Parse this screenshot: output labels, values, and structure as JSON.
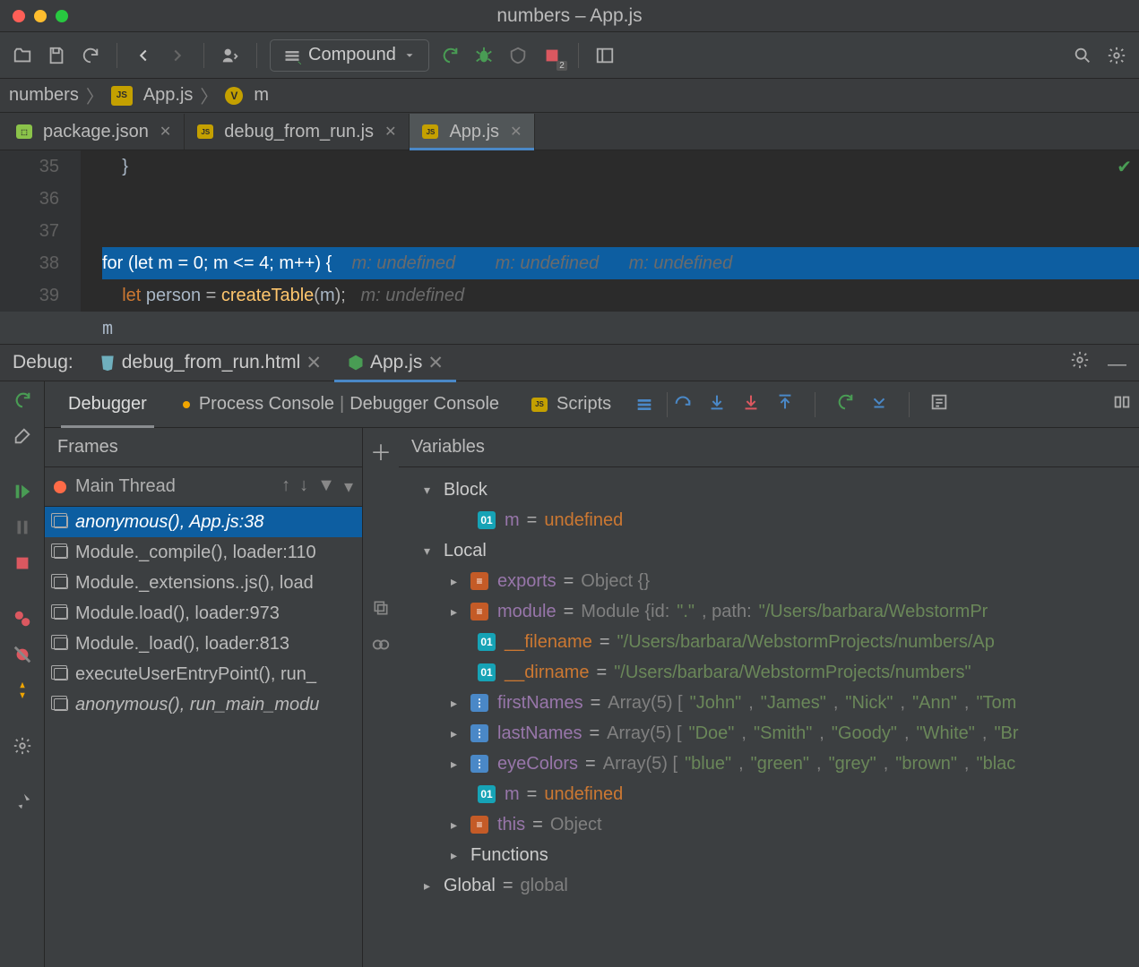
{
  "window_title": "numbers – App.js",
  "toolbar": {
    "run_config": "Compound"
  },
  "breadcrumb": {
    "project": "numbers",
    "file": "App.js",
    "symbol": "m"
  },
  "editor_tabs": [
    {
      "label": "package.json",
      "active": false
    },
    {
      "label": "debug_from_run.js",
      "active": false
    },
    {
      "label": "App.js",
      "active": true
    }
  ],
  "editor": {
    "lines": [
      "35",
      "36",
      "37",
      "38",
      "39"
    ],
    "line35": "}",
    "line38": {
      "code": "for (let m = 0; m <= 4; m++) {",
      "hint1": "m: undefined",
      "hint2": "m: undefined",
      "hint3": "m: undefined"
    },
    "line39": {
      "code": "    let person = createTable(m);",
      "hint": "m: undefined"
    },
    "extra_line": "m"
  },
  "debug": {
    "label": "Debug:",
    "tabs": [
      {
        "label": "debug_from_run.html",
        "active": false
      },
      {
        "label": "App.js",
        "active": true
      }
    ],
    "sub_tabs": {
      "debugger": "Debugger",
      "process": "Process Console",
      "dbgcon": "Debugger Console",
      "scripts": "Scripts"
    },
    "frames_label": "Frames",
    "variables_label": "Variables",
    "thread": "Main Thread",
    "frames": [
      {
        "text": "anonymous(), App.js:38",
        "sel": true,
        "italic": true
      },
      {
        "text": "Module._compile(), loader:110"
      },
      {
        "text": "Module._extensions..js(), load"
      },
      {
        "text": "Module.load(), loader:973"
      },
      {
        "text": "Module._load(), loader:813"
      },
      {
        "text": "executeUserEntryPoint(), run_"
      },
      {
        "text": "anonymous(), run_main_modu",
        "italic": true
      }
    ],
    "variables": {
      "block_label": "Block",
      "block_m_name": "m",
      "block_m_val": "undefined",
      "local_label": "Local",
      "exports_name": "exports",
      "exports_val": "Object {}",
      "module_name": "module",
      "module_val": "Module {id: \".\", path: \"/Users/barbara/WebstormPr",
      "filename_name": "__filename",
      "filename_val": "\"/Users/barbara/WebstormProjects/numbers/Ap",
      "dirname_name": "__dirname",
      "dirname_val": "\"/Users/barbara/WebstormProjects/numbers\"",
      "first_name": "firstNames",
      "first_val": "Array(5) [\"John\", \"James\", \"Nick\", \"Ann\", \"Tom",
      "last_name": "lastNames",
      "last_val": "Array(5) [\"Doe\", \"Smith\", \"Goody\", \"White\", \"Br",
      "eye_name": "eyeColors",
      "eye_val": "Array(5) [\"blue\", \"green\", \"grey\", \"brown\", \"blac",
      "local_m_name": "m",
      "local_m_val": "undefined",
      "this_name": "this",
      "this_val": "Object",
      "functions_label": "Functions",
      "global_name": "Global",
      "global_val": "global"
    }
  }
}
